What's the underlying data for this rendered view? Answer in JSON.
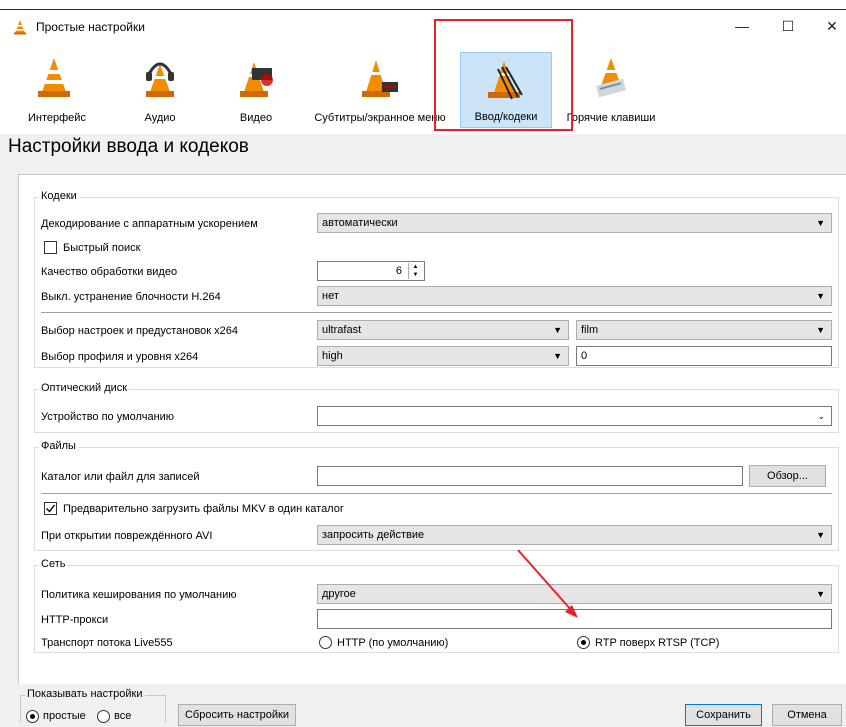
{
  "window": {
    "title": "Простые настройки",
    "minimize": "—",
    "maximize": "☐",
    "close": "✕"
  },
  "toolbar": {
    "interface": "Интерфейс",
    "audio": "Аудио",
    "video": "Видео",
    "subtitles": "Субтитры/экранное меню",
    "input": "Ввод/кодеки",
    "hotkeys": "Горячие клавиши"
  },
  "page_title": "Настройки ввода и кодеков",
  "codecs": {
    "title": "Кодеки",
    "hw_label": "Декодирование с аппаратным ускорением",
    "hw_value": "автоматически",
    "fast_seek": "Быстрый поиск",
    "quality_label": "Качество обработки видео",
    "quality_value": "6",
    "deblock_label": "Выкл. устранение блочности H.264",
    "deblock_value": "нет",
    "x264_preset_label": "Выбор настроек и предустановок x264",
    "x264_preset": "ultrafast",
    "x264_tune": "film",
    "x264_profile_label": "Выбор профиля и уровня x264",
    "x264_profile": "high",
    "x264_level": "0"
  },
  "optical": {
    "title": "Оптический диск",
    "device_label": "Устройство по умолчанию",
    "device_value": ""
  },
  "files": {
    "title": "Файлы",
    "record_label": "Каталог или файл для записей",
    "record_value": "",
    "browse": "Обзор...",
    "mkv_preload": "Предварительно загрузить файлы MKV в один каталог",
    "avi_label": "При открытии повреждённого AVI",
    "avi_value": "запросить действие"
  },
  "network": {
    "title": "Сеть",
    "cache_label": "Политика кеширования по умолчанию",
    "cache_value": "другое",
    "proxy_label": "HTTP-прокси",
    "proxy_value": "",
    "transport_label": "Транспорт потока Live555",
    "http_option": "HTTP (по умолчанию)",
    "rtsp_option": "RTP поверх RTSP (TCP)"
  },
  "bottom": {
    "show_title": "Показывать настройки",
    "simple": "простые",
    "all": "все",
    "reset": "Сбросить настройки",
    "save": "Сохранить",
    "cancel": "Отмена"
  },
  "colors": {
    "accent_highlight": "#e8202a",
    "selection": "#cce4f7",
    "cone_orange": "#f28c00"
  }
}
